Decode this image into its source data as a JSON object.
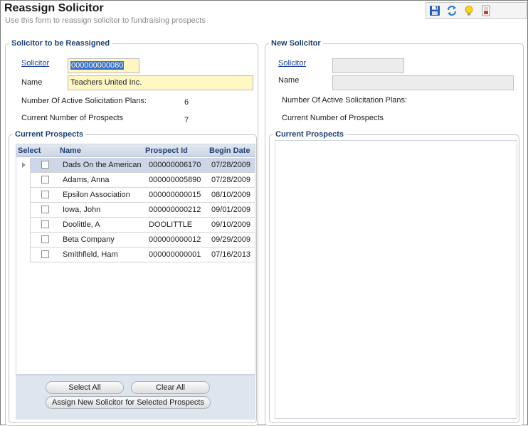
{
  "header": {
    "title": "Reassign Solicitor",
    "subtitle": "Use this form to reassign solicitor to fundraising prospects"
  },
  "toolbar": {
    "icons": [
      "save-icon",
      "refresh-icon",
      "lightbulb-icon",
      "report-icon"
    ]
  },
  "old_solicitor": {
    "group_title": "Solicitor to be Reassigned",
    "solicitor_label": "Solicitor",
    "solicitor_value": "000000000080",
    "name_label": "Name",
    "name_value": "Teachers United Inc.",
    "plans_label": "Number Of Active Solicitation Plans:",
    "plans_value": "6",
    "prospects_label": "Current Number of Prospects",
    "prospects_value": "7"
  },
  "current_prospects": {
    "group_title": "Current Prospects",
    "columns": [
      "Select",
      "Name",
      "Prospect Id",
      "Begin Date"
    ],
    "rows": [
      {
        "name": "Dads On the American",
        "id": "000000006170",
        "date": "07/28/2009"
      },
      {
        "name": "Adams, Anna",
        "id": "000000005890",
        "date": "07/28/2009"
      },
      {
        "name": "Epsilon Association",
        "id": "000000000015",
        "date": "08/10/2009"
      },
      {
        "name": "Iowa, John",
        "id": "000000000212",
        "date": "09/01/2009"
      },
      {
        "name": "Doolittle, A",
        "id": "DOOLITTLE",
        "date": "09/10/2009"
      },
      {
        "name": "Beta Company",
        "id": "000000000012",
        "date": "09/29/2009"
      },
      {
        "name": "Smithfield, Ham",
        "id": "000000000001",
        "date": "07/16/2013"
      }
    ],
    "select_all_label": "Select All",
    "clear_all_label": "Clear All",
    "assign_label": "Assign New Solicitor for Selected Prospects"
  },
  "new_solicitor": {
    "group_title": "New Solicitor",
    "solicitor_label": "Solicitor",
    "solicitor_value": "",
    "name_label": "Name",
    "name_value": "",
    "plans_label": "Number Of Active Solicitation Plans:",
    "prospects_label": "Current Number of Prospects",
    "current_prospects_title": "Current Prospects"
  },
  "colors": {
    "group_title": "#1f3f6f",
    "link": "#1d3f8f",
    "input_highlight": "#fff8c4",
    "selected_row": "#ccd6e6"
  }
}
